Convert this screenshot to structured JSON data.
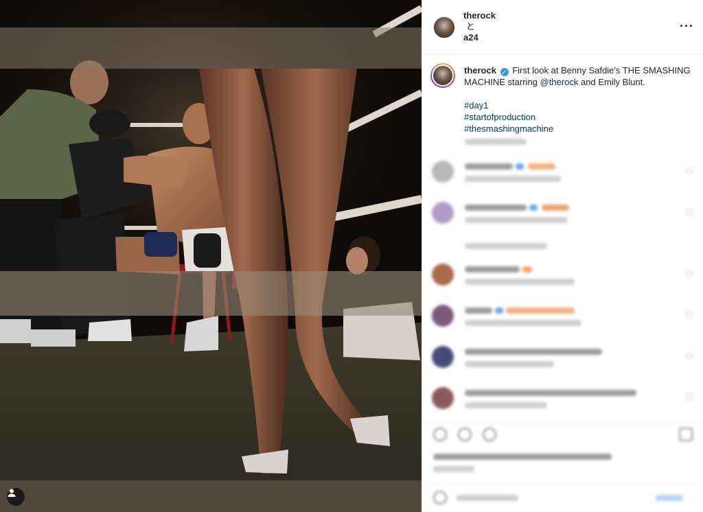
{
  "header": {
    "user1": "therock",
    "connector": "と",
    "user2": "a24",
    "more_icon": "more-horizontal-icon"
  },
  "caption": {
    "username": "therock",
    "verified_mark": "✓",
    "text_before_mention": "First look at Benny Safdie's THE SMASHING MACHINE starring ",
    "mention": "@therock",
    "text_after_mention": " and Emily Blunt.",
    "hashtags": [
      "#day1",
      "#startofproduction",
      "#thesmashingmachine"
    ]
  },
  "colors": {
    "link": "#00376b",
    "verified": "#3897f0",
    "border": "#efefef"
  }
}
